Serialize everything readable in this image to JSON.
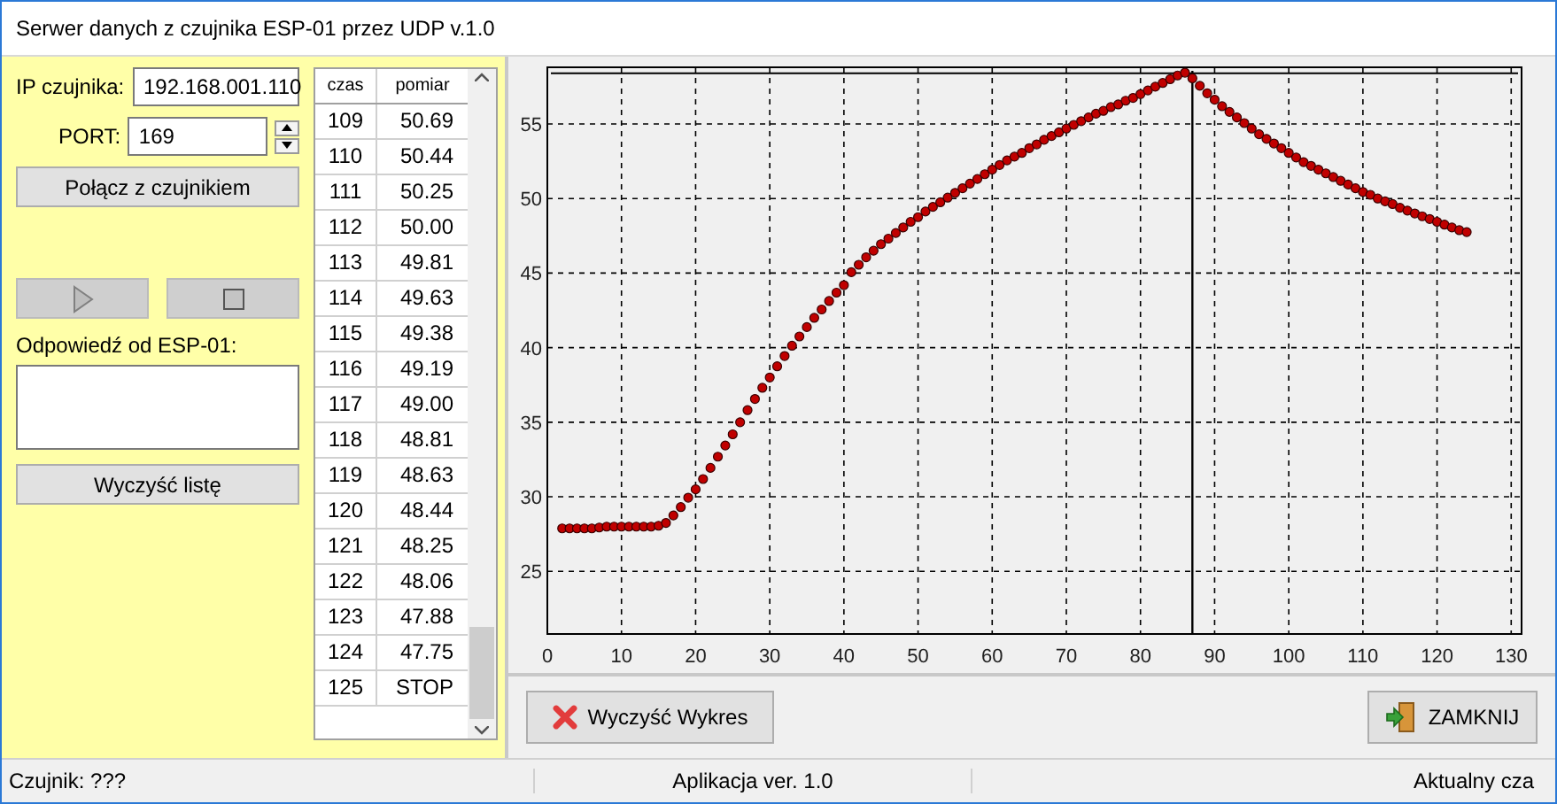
{
  "window": {
    "title": "Serwer danych z czujnika ESP-01 przez UDP v.1.0"
  },
  "left_panel": {
    "ip_label": "IP czujnika:",
    "ip_value": "192.168.001.110",
    "port_label": "PORT:",
    "port_value": "169",
    "connect_button": "Połącz z czujnikiem",
    "play_disabled": true,
    "stop_disabled": true,
    "response_label": "Odpowiedź od ESP-01:",
    "clear_list_button": "Wyczyść listę"
  },
  "table": {
    "columns": [
      "czas",
      "pomiar"
    ],
    "rows": [
      [
        "109",
        "50.69"
      ],
      [
        "110",
        "50.44"
      ],
      [
        "111",
        "50.25"
      ],
      [
        "112",
        "50.00"
      ],
      [
        "113",
        "49.81"
      ],
      [
        "114",
        "49.63"
      ],
      [
        "115",
        "49.38"
      ],
      [
        "116",
        "49.19"
      ],
      [
        "117",
        "49.00"
      ],
      [
        "118",
        "48.81"
      ],
      [
        "119",
        "48.63"
      ],
      [
        "120",
        "48.44"
      ],
      [
        "121",
        "48.25"
      ],
      [
        "122",
        "48.06"
      ],
      [
        "123",
        "47.88"
      ],
      [
        "124",
        "47.75"
      ],
      [
        "125",
        "STOP"
      ]
    ]
  },
  "chart": {
    "chart_data": {
      "type": "scatter",
      "xlim": [
        0,
        131.4
      ],
      "ylim": [
        20.8,
        58.8
      ],
      "xticks": [
        0,
        10,
        20,
        30,
        40,
        50,
        60,
        70,
        80,
        90,
        100,
        110,
        120,
        130
      ],
      "yticks": [
        25,
        30,
        35,
        40,
        45,
        50,
        55
      ],
      "x": [
        2,
        3,
        4,
        5,
        6,
        7,
        8,
        9,
        10,
        11,
        12,
        13,
        14,
        15,
        16,
        17,
        18,
        19,
        20,
        21,
        22,
        23,
        24,
        25,
        26,
        27,
        28,
        29,
        30,
        31,
        32,
        33,
        34,
        35,
        36,
        37,
        38,
        39,
        40,
        41,
        42,
        43,
        44,
        45,
        46,
        47,
        48,
        49,
        50,
        51,
        52,
        53,
        54,
        55,
        56,
        57,
        58,
        59,
        60,
        61,
        62,
        63,
        64,
        65,
        66,
        67,
        68,
        69,
        70,
        71,
        72,
        73,
        74,
        75,
        76,
        77,
        78,
        79,
        80,
        81,
        82,
        83,
        84,
        85,
        86,
        87,
        88,
        89,
        90,
        91,
        92,
        93,
        94,
        95,
        96,
        97,
        98,
        99,
        100,
        101,
        102,
        103,
        104,
        105,
        106,
        107,
        108,
        109,
        110,
        111,
        112,
        113,
        114,
        115,
        116,
        117,
        118,
        119,
        120,
        121,
        122,
        123,
        124
      ],
      "series": [
        {
          "color": "#c00000",
          "values": [
            27.88,
            27.88,
            27.88,
            27.88,
            27.88,
            27.94,
            28.0,
            28.0,
            28.0,
            28.0,
            28.0,
            28.0,
            28.0,
            28.06,
            28.25,
            28.75,
            29.31,
            29.94,
            30.5,
            31.19,
            31.94,
            32.69,
            33.44,
            34.19,
            35.0,
            35.81,
            36.56,
            37.31,
            38.0,
            38.75,
            39.44,
            40.13,
            40.75,
            41.38,
            42.0,
            42.56,
            43.13,
            43.69,
            44.19,
            45.06,
            45.56,
            46.06,
            46.5,
            46.94,
            47.31,
            47.69,
            48.06,
            48.44,
            48.75,
            49.13,
            49.44,
            49.75,
            50.06,
            50.38,
            50.69,
            51.0,
            51.31,
            51.63,
            51.94,
            52.25,
            52.56,
            52.81,
            53.06,
            53.38,
            53.63,
            53.94,
            54.19,
            54.44,
            54.69,
            54.94,
            55.19,
            55.44,
            55.69,
            55.88,
            56.13,
            56.31,
            56.56,
            56.75,
            57.0,
            57.25,
            57.5,
            57.75,
            58.0,
            58.25,
            58.44,
            58.06,
            57.56,
            57.06,
            56.63,
            56.19,
            55.81,
            55.44,
            55.06,
            54.69,
            54.31,
            54.0,
            53.69,
            53.38,
            53.06,
            52.75,
            52.44,
            52.19,
            51.94,
            51.69,
            51.44,
            51.19,
            50.94,
            50.69,
            50.44,
            50.25,
            50.0,
            49.81,
            49.63,
            49.38,
            49.19,
            49.0,
            48.81,
            48.63,
            48.44,
            48.25,
            48.06,
            47.88,
            47.75
          ]
        }
      ],
      "grid": true,
      "ref_lines": [
        {
          "axis": "x",
          "value": 87
        },
        {
          "axis": "y",
          "value": 58.4
        }
      ]
    }
  },
  "buttons": [
    {
      "kind": "clear",
      "label": "Wyczyść Wykres"
    },
    {
      "kind": "close",
      "label": "ZAMKNIJ"
    }
  ],
  "status_bar": [
    "Czujnik: ???",
    "Aplikacja ver. 1.0",
    "Aktualny cza"
  ]
}
